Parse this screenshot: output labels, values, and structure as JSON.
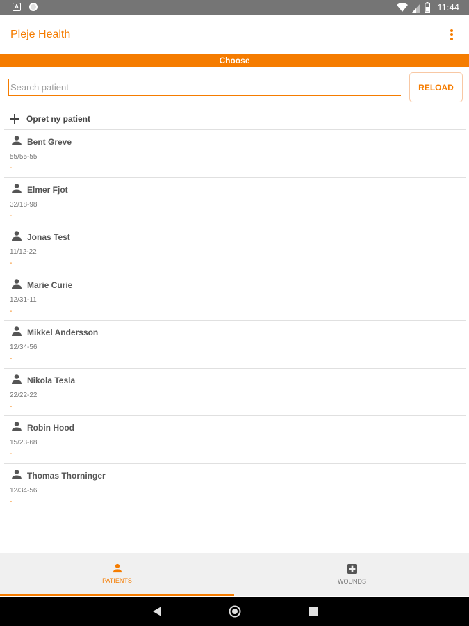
{
  "status_bar": {
    "left_icons": [
      "android-notification-icon",
      "circle-notification-icon"
    ],
    "a_glyph": "A",
    "right_icons": [
      "wifi-icon",
      "signal-icon",
      "battery-icon"
    ],
    "time": "11:44"
  },
  "app_bar": {
    "title": "Pleje Health",
    "menu_icon": "overflow-menu-icon"
  },
  "banner": {
    "label": "Choose"
  },
  "search": {
    "placeholder": "Search patient",
    "value": ""
  },
  "reload_button": {
    "label": "RELOAD"
  },
  "new_patient": {
    "label": "Opret ny patient",
    "icon": "plus-icon"
  },
  "patients": [
    {
      "name": "Bent Greve",
      "date": "55/55-55",
      "extra": "-"
    },
    {
      "name": "Elmer Fjot",
      "date": "32/18-98",
      "extra": "-"
    },
    {
      "name": "Jonas Test",
      "date": "11/12-22",
      "extra": "-"
    },
    {
      "name": "Marie Curie",
      "date": "12/31-11",
      "extra": "-"
    },
    {
      "name": "Mikkel Andersson",
      "date": "12/34-56",
      "extra": "-"
    },
    {
      "name": "Nikola Tesla",
      "date": "22/22-22",
      "extra": "-"
    },
    {
      "name": "Robin Hood",
      "date": "15/23-68",
      "extra": "-"
    },
    {
      "name": "Thomas Thorninger",
      "date": "12/34-56",
      "extra": "-"
    }
  ],
  "bottom_nav": {
    "tabs": [
      {
        "label": "PATIENTS",
        "icon": "person-icon",
        "active": true
      },
      {
        "label": "WOUNDS",
        "icon": "medical-plus-icon",
        "active": false
      }
    ]
  },
  "colors": {
    "accent": "#f57c00",
    "status_bar": "#757575",
    "nav_background": "#f0f0f0"
  },
  "system_nav": {
    "buttons": [
      "back-icon",
      "home-icon",
      "recents-icon"
    ]
  }
}
